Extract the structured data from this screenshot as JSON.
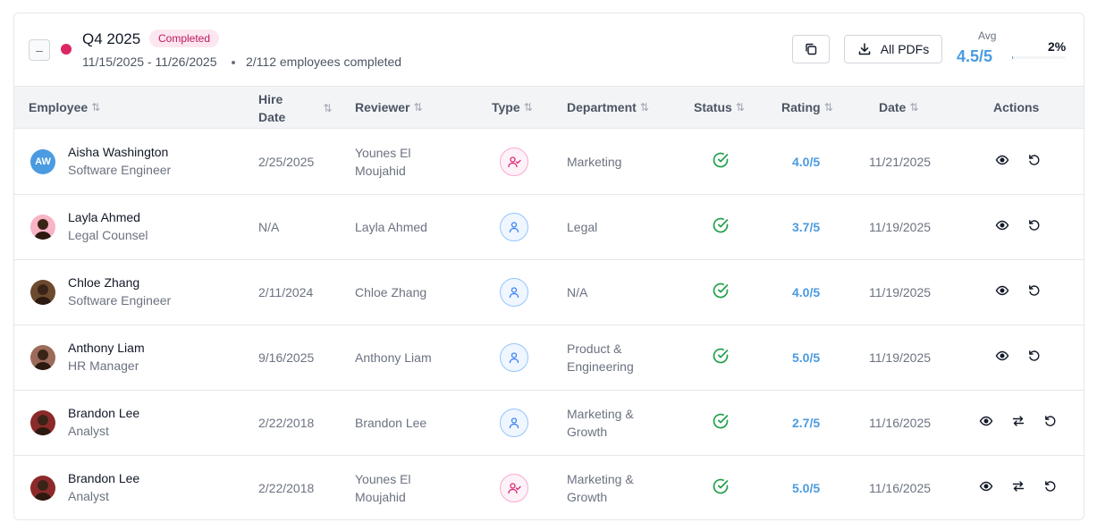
{
  "header": {
    "period_title": "Q4 2025",
    "status_badge": "Completed",
    "date_range": "11/15/2025 - 11/26/2025",
    "employees_completed": "2/112 employees completed",
    "pdf_button_label": "All PDFs",
    "avg_label": "Avg",
    "avg_value": "4.5/5",
    "completion_percent_label": "2%",
    "completion_fraction": 0.02,
    "collapse_symbol": "–"
  },
  "columns": {
    "employee": "Employee",
    "hire_date_1": "Hire",
    "hire_date_2": "Date",
    "reviewer": "Reviewer",
    "type": "Type",
    "department": "Department",
    "status": "Status",
    "rating": "Rating",
    "date": "Date",
    "actions": "Actions"
  },
  "rows": [
    {
      "name": "Aisha Washington",
      "title": "Software Engineer",
      "initials": "AW",
      "hire_date": "2/25/2025",
      "reviewer_1": "Younes El",
      "reviewer_2": "Moujahid",
      "type": "manager",
      "dept_1": "Marketing",
      "dept_2": "",
      "rating": "4.0/5",
      "date": "11/21/2025",
      "actions": [
        "view-icon",
        "reset-icon"
      ]
    },
    {
      "name": "Layla Ahmed",
      "title": "Legal Counsel",
      "initials": "",
      "hire_date": "N/A",
      "reviewer_1": "Layla Ahmed",
      "reviewer_2": "",
      "type": "self",
      "dept_1": "Legal",
      "dept_2": "",
      "rating": "3.7/5",
      "date": "11/19/2025",
      "actions": [
        "view-icon",
        "reset-icon"
      ]
    },
    {
      "name": "Chloe Zhang",
      "title": "Software Engineer",
      "initials": "",
      "hire_date": "2/11/2024",
      "reviewer_1": "Chloe Zhang",
      "reviewer_2": "",
      "type": "self",
      "dept_1": "N/A",
      "dept_2": "",
      "rating": "4.0/5",
      "date": "11/19/2025",
      "actions": [
        "view-icon",
        "reset-icon"
      ]
    },
    {
      "name": "Anthony Liam",
      "title": "HR Manager",
      "initials": "",
      "hire_date": "9/16/2025",
      "reviewer_1": "Anthony Liam",
      "reviewer_2": "",
      "type": "self",
      "dept_1": "Product &",
      "dept_2": "Engineering",
      "rating": "5.0/5",
      "date": "11/19/2025",
      "actions": [
        "view-icon",
        "reset-icon"
      ]
    },
    {
      "name": "Brandon Lee",
      "title": "Analyst",
      "initials": "",
      "hire_date": "2/22/2018",
      "reviewer_1": "Brandon Lee",
      "reviewer_2": "",
      "type": "self",
      "dept_1": "Marketing &",
      "dept_2": "Growth",
      "rating": "2.7/5",
      "date": "11/16/2025",
      "actions": [
        "view-icon",
        "swap-icon",
        "reset-icon"
      ]
    },
    {
      "name": "Brandon Lee",
      "title": "Analyst",
      "initials": "",
      "hire_date": "2/22/2018",
      "reviewer_1": "Younes El",
      "reviewer_2": "Moujahid",
      "type": "manager",
      "dept_1": "Marketing &",
      "dept_2": "Growth",
      "rating": "5.0/5",
      "date": "11/16/2025",
      "actions": [
        "view-icon",
        "swap-icon",
        "reset-icon"
      ]
    }
  ],
  "colors": {
    "accent": "#4a9be0",
    "status_dot": "#dc2662",
    "success": "#22a04b",
    "badge_bg": "#fce7f0",
    "badge_text": "#be185d"
  },
  "icons": {
    "collapse": "minus-icon",
    "copy": "copy-icon",
    "download": "download-icon",
    "sort": "sort-icon",
    "status": "check-circle-icon",
    "type_manager": "user-check-icon",
    "type_self": "user-icon"
  }
}
